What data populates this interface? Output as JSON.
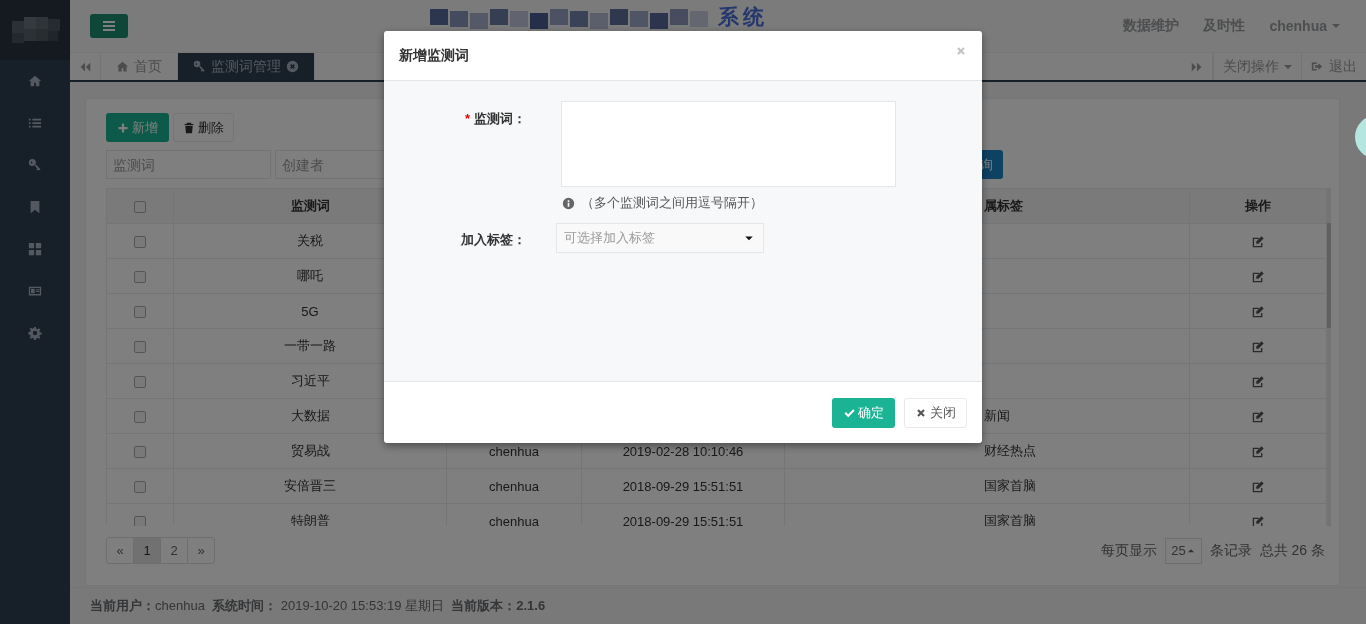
{
  "sidebar": {
    "items": [
      {
        "kind": "home"
      },
      {
        "kind": "list"
      },
      {
        "kind": "key"
      },
      {
        "kind": "bookmark"
      },
      {
        "kind": "grid"
      },
      {
        "kind": "card"
      },
      {
        "kind": "gear"
      }
    ]
  },
  "header": {
    "title": "系统",
    "links": [
      "数据维护",
      "及时性"
    ],
    "user": "chenhua"
  },
  "tab_bar": {
    "tabs": [
      {
        "label": "首页",
        "selected": false,
        "closable": false
      },
      {
        "label": "监测词管理",
        "selected": true,
        "closable": true
      }
    ],
    "close_menu": "关闭操作",
    "logout": "退出"
  },
  "toolbar": {
    "buttons": [
      {
        "label": "新增",
        "kind": "primary"
      },
      {
        "label": "删除",
        "kind": "default"
      }
    ]
  },
  "filters": [
    {
      "placeholder": "监测词"
    },
    {
      "placeholder": "创建者"
    }
  ],
  "search_button": "询",
  "table": {
    "header": {
      "checked": false,
      "word": "监测词",
      "tag": "属标签",
      "actions": "操作"
    },
    "rows": [
      {
        "checked": false,
        "word": "关税"
      },
      {
        "checked": false,
        "word": "哪吒"
      },
      {
        "checked": false,
        "word": "5G"
      },
      {
        "checked": false,
        "word": "一带一路"
      },
      {
        "checked": false,
        "word": "习近平"
      },
      {
        "checked": false,
        "word": "大数据",
        "tag": "新闻"
      },
      {
        "checked": false,
        "word": "贸易战",
        "creator": "chenhua",
        "created": "2019-02-28 10:10:46",
        "tag": "财经热点"
      },
      {
        "checked": false,
        "word": "安倍晋三",
        "creator": "chenhua",
        "created": "2018-09-29 15:51:51",
        "tag": "国家首脑"
      },
      {
        "checked": false,
        "word": "特朗普",
        "creator": "chenhua",
        "created": "2018-09-29 15:51:51",
        "tag": "国家首脑"
      }
    ]
  },
  "pagination": {
    "prev": "«",
    "pages": [
      {
        "label": "1",
        "selected": true
      },
      {
        "label": "2",
        "selected": false
      }
    ],
    "next": "»"
  },
  "page_size": {
    "label": "每页显示",
    "value": "25",
    "suffix": "条记录",
    "total": "总共 26 条"
  },
  "status_bar": {
    "text": "**当前用户：**chenhua  **系统时间：** 2019-10-20 15:53:19 星期日  **当前版本：2.1.6**"
  },
  "modal": {
    "title": "新增监测词",
    "fields": [
      {
        "kind": "textarea",
        "label": "监测词：",
        "required_mark": "*",
        "hint": "（多个监测词之间用逗号隔开）"
      },
      {
        "kind": "select",
        "label": "加入标签：",
        "placeholder": "可选择加入标签"
      }
    ],
    "buttons": [
      {
        "label": "确定",
        "kind": "primary"
      },
      {
        "label": "关闭",
        "kind": "default"
      }
    ]
  }
}
